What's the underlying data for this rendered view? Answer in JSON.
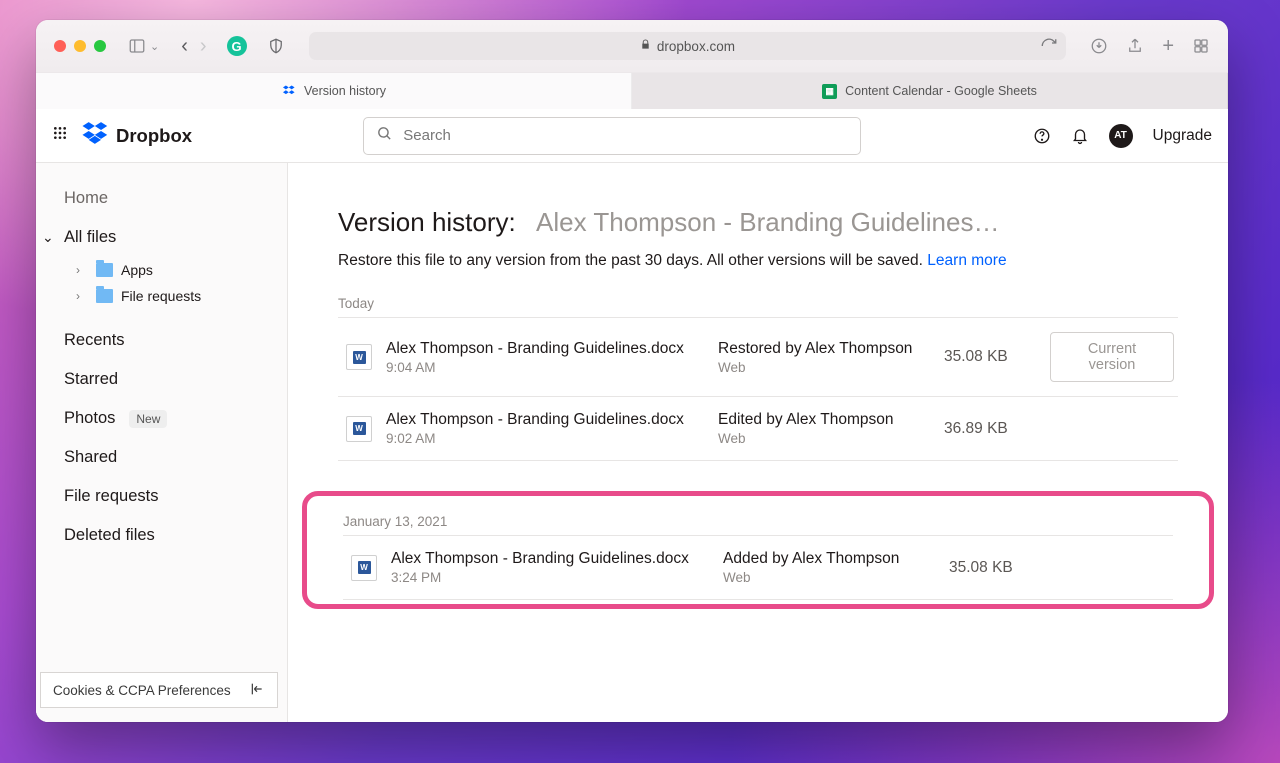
{
  "browser": {
    "url_host": "dropbox.com",
    "tabs": [
      {
        "label": "Version history",
        "favicon": "dropbox"
      },
      {
        "label": "Content Calendar - Google Sheets",
        "favicon": "sheets"
      }
    ]
  },
  "topbar": {
    "brand": "Dropbox",
    "search_placeholder": "Search",
    "avatar_initials": "AT",
    "upgrade_label": "Upgrade"
  },
  "sidebar": {
    "home": "Home",
    "all_files": "All files",
    "tree": [
      {
        "label": "Apps"
      },
      {
        "label": "File requests"
      }
    ],
    "recents": "Recents",
    "starred": "Starred",
    "photos": "Photos",
    "photos_badge": "New",
    "shared": "Shared",
    "file_requests": "File requests",
    "deleted": "Deleted files",
    "cookies": "Cookies & CCPA Preferences"
  },
  "page": {
    "title_prefix": "Version history:",
    "title_filename": "Alex Thompson - Branding Guidelines…",
    "subtitle_text": "Restore this file to any version from the past 30 days. All other versions will be saved.",
    "learn_more": "Learn more",
    "sections": [
      {
        "label": "Today",
        "rows": [
          {
            "filename": "Alex Thompson - Branding Guidelines.docx",
            "time": "9:04 AM",
            "action": "Restored by Alex Thompson",
            "source": "Web",
            "size": "35.08 KB",
            "current": true
          },
          {
            "filename": "Alex Thompson - Branding Guidelines.docx",
            "time": "9:02 AM",
            "action": "Edited by Alex Thompson",
            "source": "Web",
            "size": "36.89 KB",
            "current": false
          }
        ]
      },
      {
        "label": "January 13, 2021",
        "highlighted": true,
        "rows": [
          {
            "filename": "Alex Thompson - Branding Guidelines.docx",
            "time": "3:24 PM",
            "action": "Added by Alex Thompson",
            "source": "Web",
            "size": "35.08 KB",
            "current": false
          }
        ]
      }
    ],
    "current_version_label": "Current version"
  }
}
